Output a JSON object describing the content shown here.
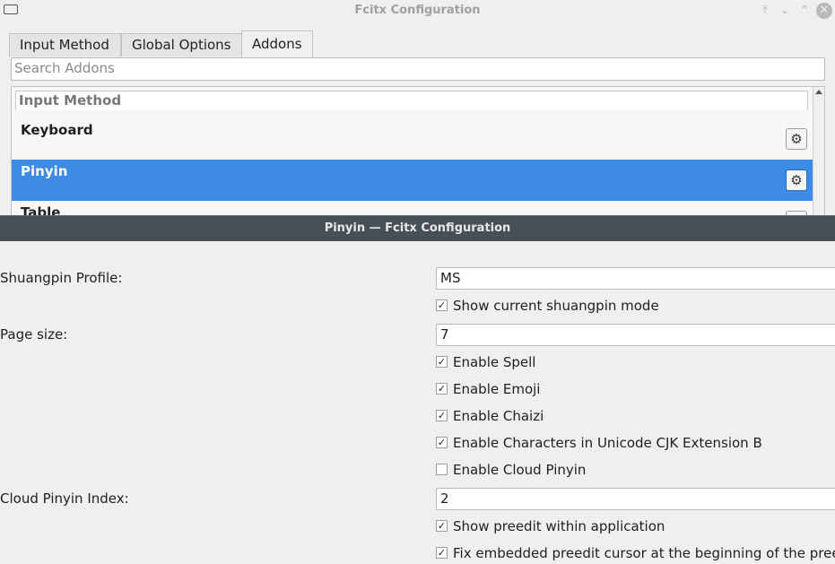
{
  "config_window": {
    "title": "Fcitx Configuration",
    "tabs": [
      {
        "label": "Input Method"
      },
      {
        "label": "Global Options"
      },
      {
        "label": "Addons"
      }
    ],
    "active_tab": "Addons",
    "search": {
      "placeholder": "Search Addons",
      "value": ""
    },
    "category": "Input Method",
    "addons": [
      {
        "label": "Keyboard",
        "selected": false
      },
      {
        "label": "Pinyin",
        "selected": true
      },
      {
        "label": "Table",
        "selected": false
      }
    ]
  },
  "pinyin_dialog": {
    "title": "Pinyin — Fcitx Configuration",
    "shuangpin_profile": {
      "label": "Shuangpin Profile:",
      "value": "MS"
    },
    "page_size": {
      "label": "Page size:",
      "value": "7"
    },
    "cloud_pinyin_index": {
      "label": "Cloud Pinyin Index:",
      "value": "2"
    },
    "checkboxes": [
      {
        "label": "Show current shuangpin mode",
        "checked": true
      },
      {
        "label": "Enable Spell",
        "checked": true
      },
      {
        "label": "Enable Emoji",
        "checked": true
      },
      {
        "label": "Enable Chaizi",
        "checked": true
      },
      {
        "label": "Enable Characters in Unicode CJK Extension B",
        "checked": true
      },
      {
        "label": "Enable Cloud Pinyin",
        "checked": false
      },
      {
        "label": "Show preedit within application",
        "checked": true
      },
      {
        "label": "Fix embedded preedit cursor at the beginning of the preedit",
        "checked": true
      }
    ]
  },
  "colors": {
    "selection": "#3d8be4",
    "dialog_titlebar": "#475057"
  },
  "icons": {
    "app": "keyboard-icon",
    "configure": "gear-icon",
    "check": "check-icon"
  }
}
